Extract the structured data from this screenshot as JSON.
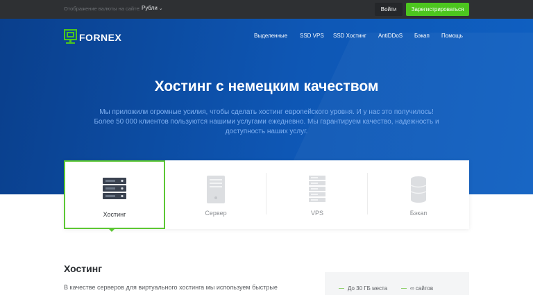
{
  "topbar": {
    "currency_text": "Отображение валюты на сайте:",
    "currency_value": "Рубли",
    "login_label": "Войти",
    "register_label": "Зарегистрироваться"
  },
  "brand": {
    "name": "FORNEX",
    "accent": "#4cc61e"
  },
  "nav": {
    "items": [
      {
        "label": "Выделенные"
      },
      {
        "label": "SSD VPS"
      },
      {
        "label": "SSD Хостинг"
      },
      {
        "label": "AntiDDoS"
      },
      {
        "label": "Бэкап"
      },
      {
        "label": "Помощь"
      }
    ]
  },
  "hero": {
    "title": "Хостинг с немецким качеством",
    "desc_line1": "Мы приложили огромные усилия, чтобы сделать хостинг европейского уровня. И у нас это получилось!",
    "desc_line2": "Более 50 000 клиентов пользуются нашими услугами ежедневно. Мы гарантируем качество, надежность и",
    "desc_line3": "доступность наших услуг."
  },
  "cards": [
    {
      "label": "Хостинг",
      "icon": "server-rack-icon",
      "active": true
    },
    {
      "label": "Сервер",
      "icon": "server-tower-icon",
      "active": false
    },
    {
      "label": "VPS",
      "icon": "vps-stack-icon",
      "active": false
    },
    {
      "label": "Бэкап",
      "icon": "database-icon",
      "active": false
    }
  ],
  "section": {
    "title": "Хостинг",
    "text": "В качестве серверов для виртуального хостинга мы используем быстрые"
  },
  "side": {
    "item1": "До 30 ГБ места",
    "item2": "∞ сайтов"
  }
}
